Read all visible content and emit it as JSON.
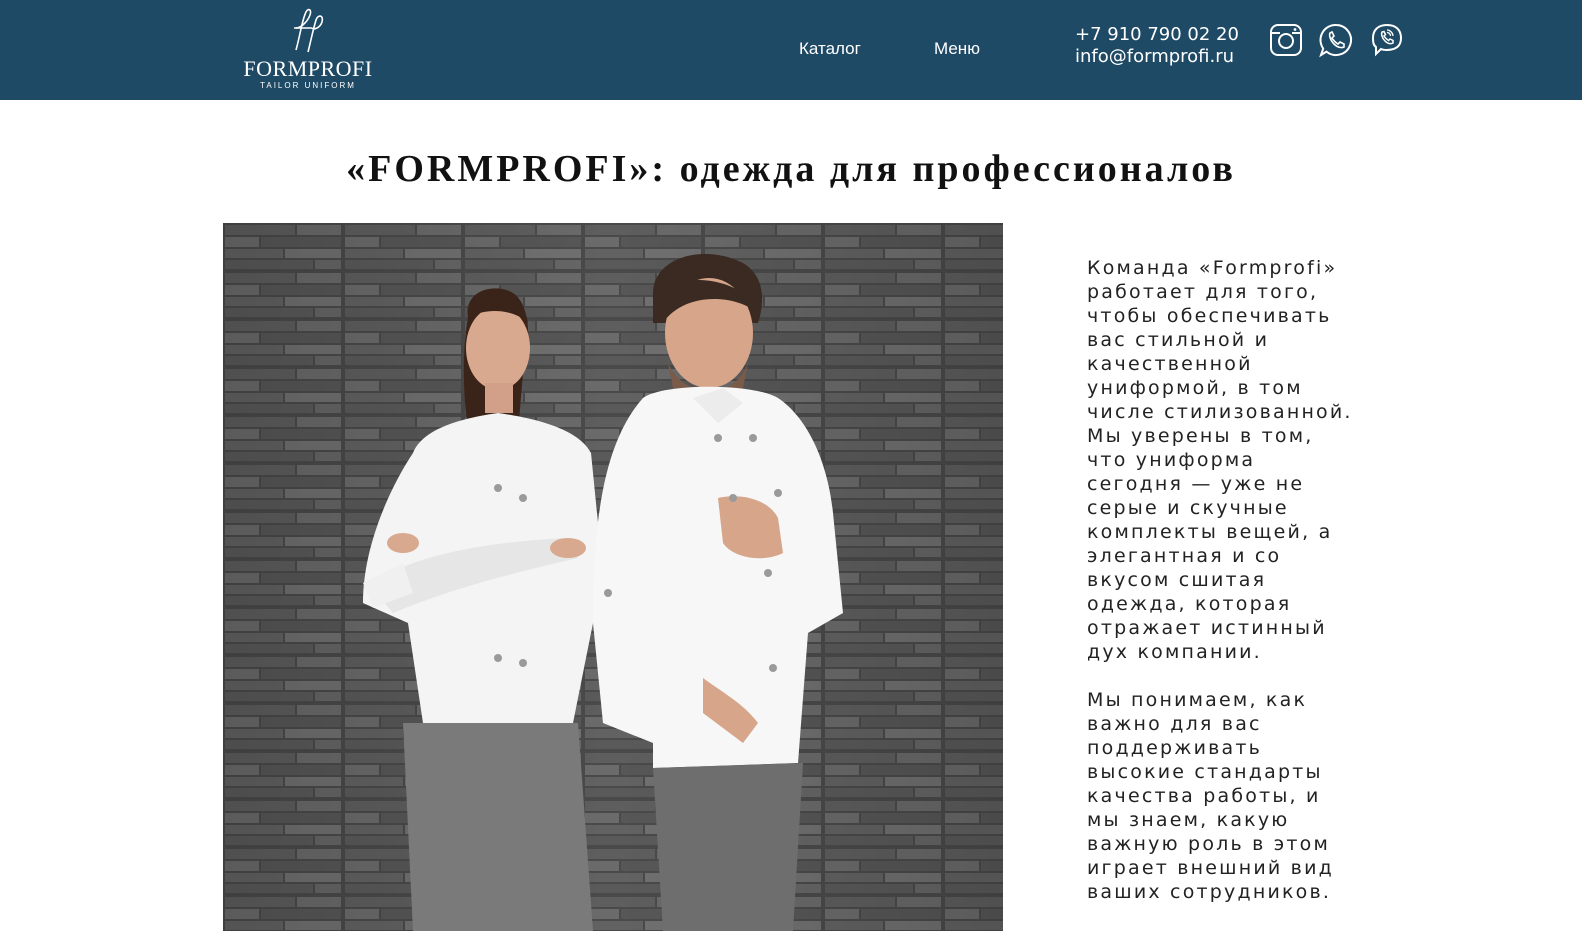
{
  "header": {
    "logo": {
      "monogram": "fp",
      "wordmark": "FORMPROFI",
      "tagline": "TAILOR UNIFORM"
    },
    "nav": [
      {
        "label": "Каталог"
      },
      {
        "label": "Меню"
      }
    ],
    "contacts": {
      "phone": "+7 910 790 02 20",
      "email": "info@formprofi.ru"
    },
    "social_icons": [
      "instagram-icon",
      "whatsapp-icon",
      "viber-icon"
    ]
  },
  "main": {
    "title": "«FORMPROFI»: одежда для профессионалов",
    "paragraphs": [
      "Команда «Formprofi» работает для того, чтобы обеспечивать вас стильной и качественной униформой, в том числе стилизованной.",
      "Мы уверены в том, что униформа сегодня — уже не серые и скучные комплекты вещей, а элегантная и со вкусом сшитая одежда, которая отражает истинный дух компании.",
      "Мы понимаем, как важно для вас поддерживать высокие стандарты качества работы, и мы знаем, какую важную роль в этом играет внешний вид ваших сотрудников."
    ]
  },
  "colors": {
    "header_bg": "#1f4a66",
    "header_text": "#ffffff",
    "body_text": "#222222"
  }
}
